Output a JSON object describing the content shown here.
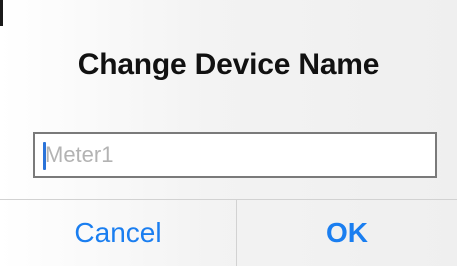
{
  "dialog": {
    "title": "Change Device Name",
    "name_field": {
      "value": "",
      "placeholder": "Meter1"
    },
    "buttons": {
      "cancel_label": "Cancel",
      "ok_label": "OK"
    }
  },
  "colors": {
    "accent": "#1a7ef0",
    "title_text": "#111111",
    "placeholder_text": "#b3b3b3",
    "separator": "#d2d2d2",
    "caret": "#2a73d9"
  }
}
